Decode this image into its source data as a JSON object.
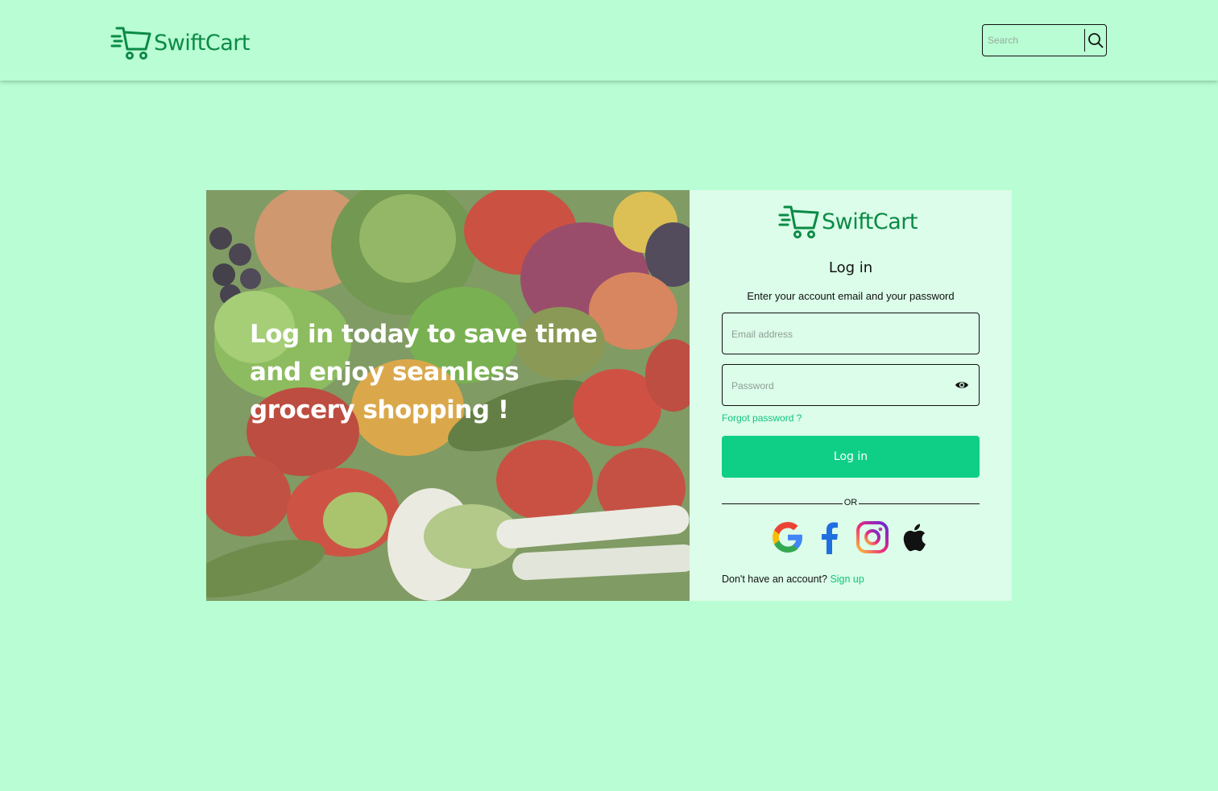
{
  "app": {
    "brand_name": "SwiftCart",
    "colors": {
      "background": "#b8fdd3",
      "panel": "#dbfde9",
      "brand": "#0b8a45",
      "accent": "#0fcf87",
      "link": "#10c47d"
    }
  },
  "header": {
    "logo_icon": "shopping-cart-speed-icon",
    "search": {
      "placeholder": "Search",
      "value": "",
      "icon": "search-icon"
    }
  },
  "hero": {
    "headline": "Log in today to save time and enjoy seamless grocery shopping !",
    "image": "fresh-vegetables-photo"
  },
  "login": {
    "title": "Log in",
    "subtitle": "Enter your account email and your password",
    "email": {
      "placeholder": "Email address",
      "value": ""
    },
    "password": {
      "placeholder": "Password",
      "value": "",
      "toggle_icon": "eye-icon"
    },
    "forgot_password": "Forgot password ?",
    "submit_label": "Log in",
    "divider_text": "OR",
    "social": [
      "google-icon",
      "facebook-icon",
      "instagram-icon",
      "apple-icon"
    ],
    "signup_prompt": "Don't have an account?",
    "signup_link": "Sign up"
  }
}
